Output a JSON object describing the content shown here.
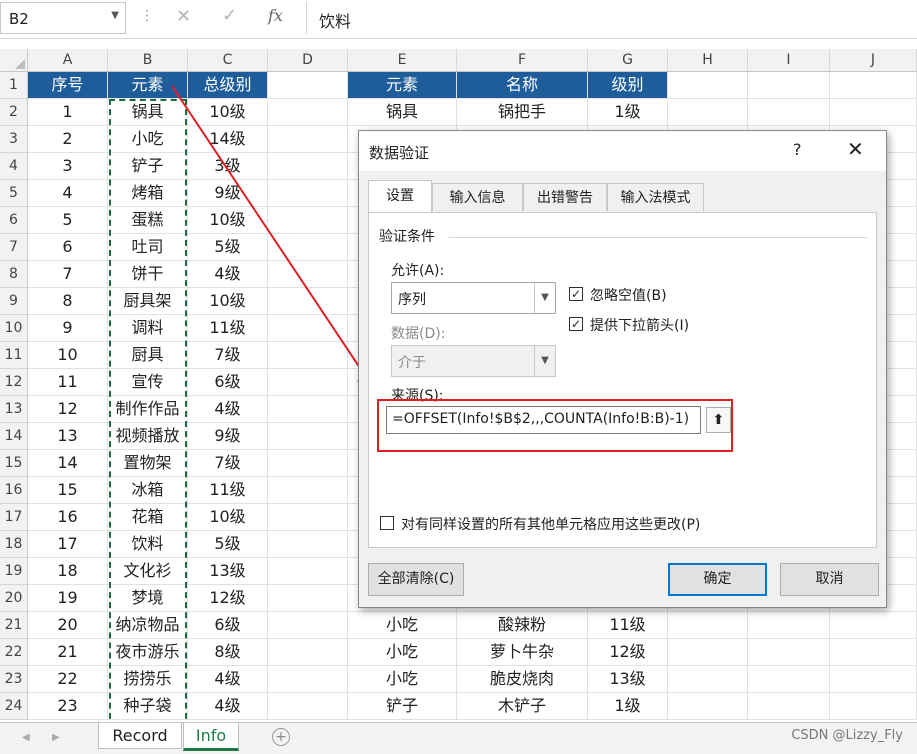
{
  "formula_bar": {
    "name_box": "B2",
    "formula": "饮料"
  },
  "columns": [
    "A",
    "B",
    "C",
    "D",
    "E",
    "F",
    "G",
    "H",
    "I",
    "J"
  ],
  "rows": [
    "1",
    "2",
    "3",
    "4",
    "5",
    "6",
    "7",
    "8",
    "9",
    "10",
    "11",
    "12",
    "13",
    "14",
    "15",
    "16",
    "17",
    "18",
    "19",
    "20",
    "21",
    "22",
    "23",
    "24"
  ],
  "left_table": {
    "headers": [
      "序号",
      "元素",
      "总级别"
    ],
    "data": [
      [
        "1",
        "锅具",
        "10级"
      ],
      [
        "2",
        "小吃",
        "14级"
      ],
      [
        "3",
        "铲子",
        "3级"
      ],
      [
        "4",
        "烤箱",
        "9级"
      ],
      [
        "5",
        "蛋糕",
        "10级"
      ],
      [
        "6",
        "吐司",
        "5级"
      ],
      [
        "7",
        "饼干",
        "4级"
      ],
      [
        "8",
        "厨具架",
        "10级"
      ],
      [
        "9",
        "调料",
        "11级"
      ],
      [
        "10",
        "厨具",
        "7级"
      ],
      [
        "11",
        "宣传",
        "6级"
      ],
      [
        "12",
        "制作作品",
        "4级"
      ],
      [
        "13",
        "视频播放",
        "9级"
      ],
      [
        "14",
        "置物架",
        "7级"
      ],
      [
        "15",
        "冰箱",
        "11级"
      ],
      [
        "16",
        "花箱",
        "10级"
      ],
      [
        "17",
        "饮料",
        "5级"
      ],
      [
        "18",
        "文化衫",
        "13级"
      ],
      [
        "19",
        "梦境",
        "12级"
      ],
      [
        "20",
        "纳凉物品",
        "6级"
      ],
      [
        "21",
        "夜市游乐",
        "8级"
      ],
      [
        "22",
        "捞捞乐",
        "4级"
      ],
      [
        "23",
        "种子袋",
        "4级"
      ]
    ]
  },
  "right_table": {
    "headers": [
      "元素",
      "名称",
      "级别"
    ],
    "top_rows": [
      [
        "锅具",
        "锅把手",
        "1级"
      ]
    ],
    "bottom_rows": [
      [
        "小吃",
        "酸辣粉",
        "11级"
      ],
      [
        "小吃",
        "萝卜牛杂",
        "12级"
      ],
      [
        "小吃",
        "脆皮烧肉",
        "13级"
      ],
      [
        "铲子",
        "木铲子",
        "1级"
      ]
    ]
  },
  "sheet_tabs": [
    "Record",
    "Info"
  ],
  "active_tab": "Info",
  "watermark": "CSDN @Lizzy_Fly",
  "dialog": {
    "title": "数据验证",
    "help": "?",
    "close": "✕",
    "tabs": [
      "设置",
      "输入信息",
      "出错警告",
      "输入法模式"
    ],
    "active_tab_index": 0,
    "group_title": "验证条件",
    "allow_label": "允许(A):",
    "allow_value": "序列",
    "data_label": "数据(D):",
    "data_value": "介于",
    "ignore_blank": "忽略空值(B)",
    "ignore_blank_checked": true,
    "dropdown": "提供下拉箭头(I)",
    "dropdown_checked": true,
    "source_label": "来源(S):",
    "source_value": "=OFFSET(Info!$B$2,,,COUNTA(Info!B:B)-1)",
    "apply_all": "对有同样设置的所有其他单元格应用这些更改(P)",
    "apply_all_checked": false,
    "clear_all": "全部清除(C)",
    "ok": "确定",
    "cancel": "取消"
  },
  "colors": {
    "header_fill": "#1f5d9a",
    "header_text": "#ffffff",
    "marquee": "#1d6b3c",
    "annotation": "#e02020",
    "active_tab": "#1f7a45"
  }
}
